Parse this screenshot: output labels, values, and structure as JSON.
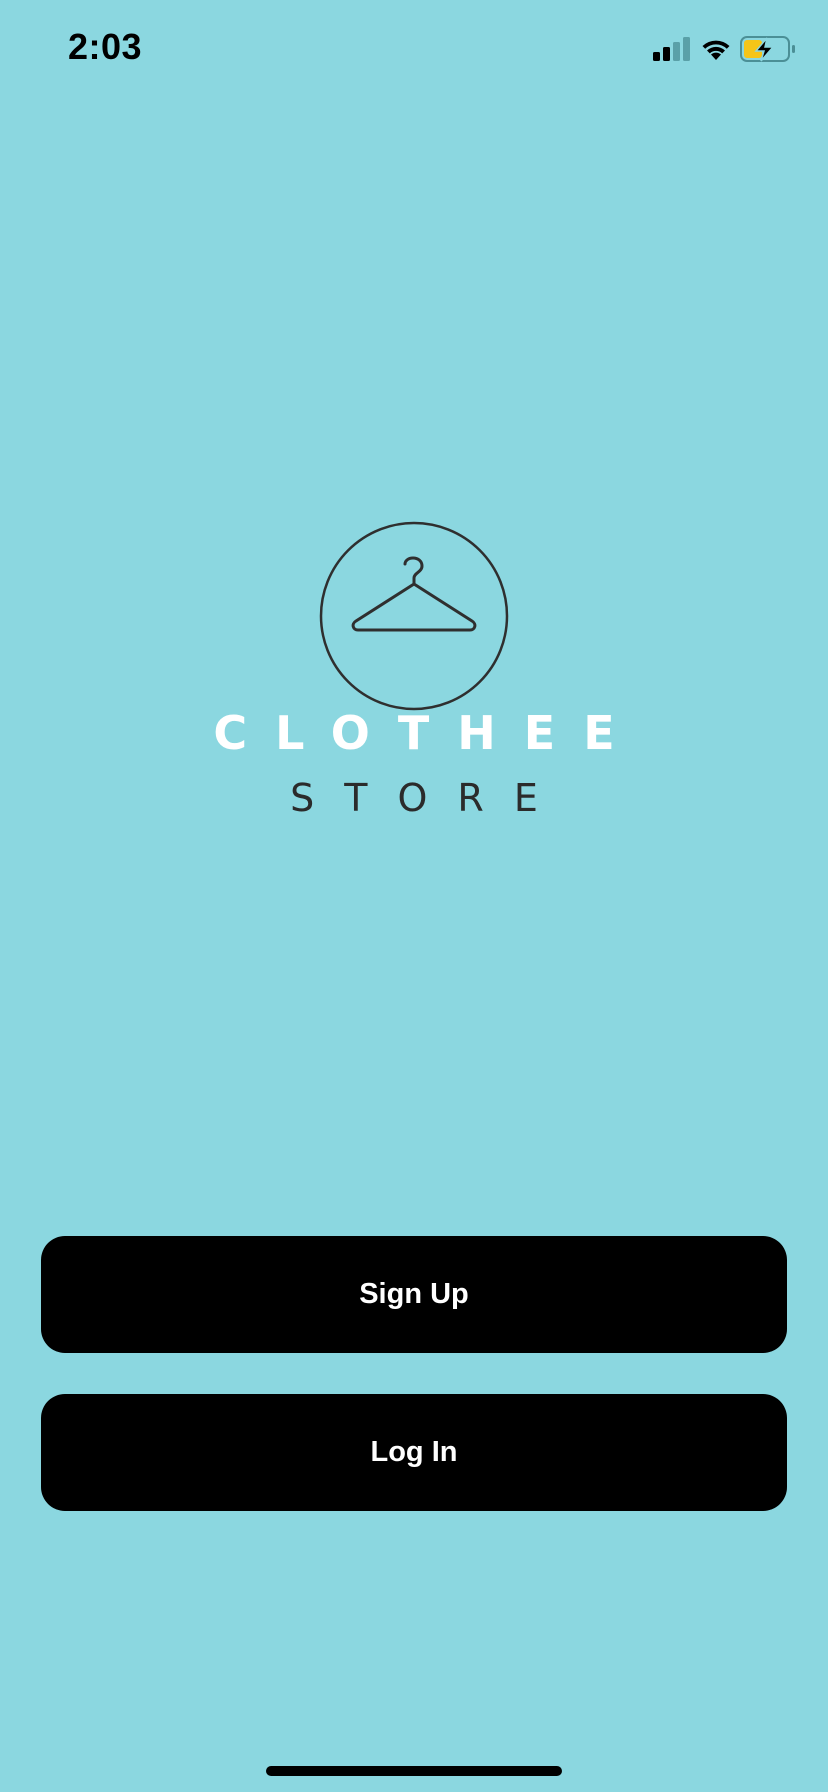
{
  "status_bar": {
    "time": "2:03",
    "signal_icon": "cellular-signal-icon",
    "wifi_icon": "wifi-icon",
    "battery_icon": "battery-charging-icon",
    "battery_color": "#f5c518"
  },
  "logo": {
    "icon": "clothes-hanger-icon",
    "title": "CLOTHEE",
    "subtitle": "STORE"
  },
  "actions": {
    "signup_label": "Sign Up",
    "login_label": "Log In"
  },
  "colors": {
    "background": "#8bd7e0",
    "button": "#000000",
    "button_text": "#ffffff",
    "title": "#ffffff",
    "subtitle": "#2b2b2b"
  }
}
